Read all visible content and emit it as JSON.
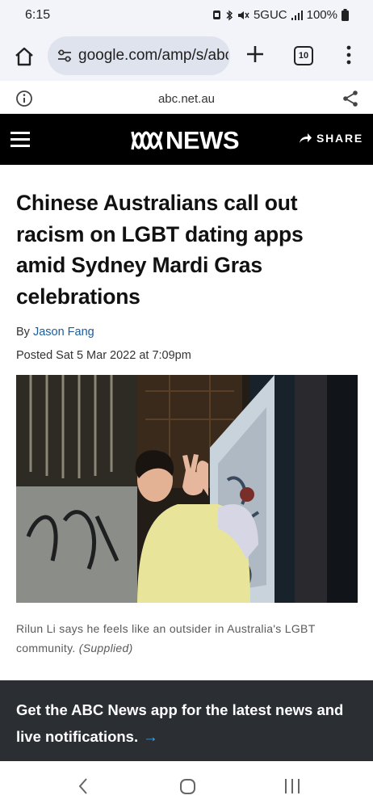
{
  "status_bar": {
    "time": "6:15",
    "network": "5GUC",
    "battery": "100%"
  },
  "browser": {
    "url": "google.com/amp/s/abc.net.au",
    "tab_count": "10"
  },
  "info_bar": {
    "domain": "abc.net.au"
  },
  "header": {
    "logo_text": "NEWS",
    "share_label": "SHARE"
  },
  "article": {
    "headline": "Chinese Australians call out racism on LGBT dating apps amid Sydney Mardi Gras celebrations",
    "byline_prefix": "By ",
    "author": "Jason Fang",
    "posted": "Posted Sat 5 Mar 2022 at 7:09pm",
    "photo_caption": "Rilun Li says he feels like an outsider in Australia's LGBT community.",
    "photo_credit": "(Supplied)"
  },
  "app_banner": {
    "text": "Get the ABC News app for the latest news and live notifications.",
    "arrow": "→"
  },
  "colors": {
    "link": "#1d5c9b",
    "banner_bg": "#2b2e33",
    "banner_arrow": "#32a8f0",
    "header_bg": "#000000"
  }
}
